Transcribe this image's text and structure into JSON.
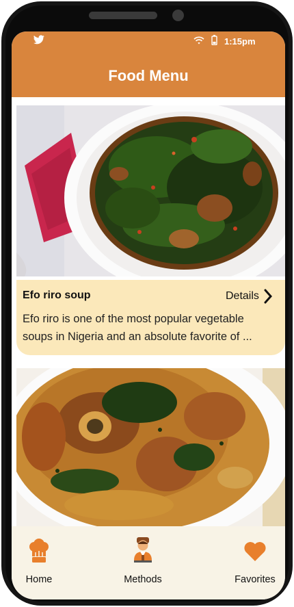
{
  "status_bar": {
    "time": "1:15pm"
  },
  "header": {
    "title": "Food Menu"
  },
  "cards": [
    {
      "title": "Efo riro soup",
      "details_label": "Details",
      "description": "Efo riro is one of the most popular vegetable soups in Nigeria and an absolute favorite of ..."
    }
  ],
  "bottom_nav": {
    "items": [
      {
        "label": "Home",
        "icon": "chef-hat-icon"
      },
      {
        "label": "Methods",
        "icon": "chef-avatar-icon"
      },
      {
        "label": "Favorites",
        "icon": "heart-icon"
      }
    ]
  },
  "colors": {
    "header": "#d9853d",
    "card_info": "#fbe8ba",
    "bottom_nav": "#f8f3e6",
    "accent": "#e87f2c"
  }
}
